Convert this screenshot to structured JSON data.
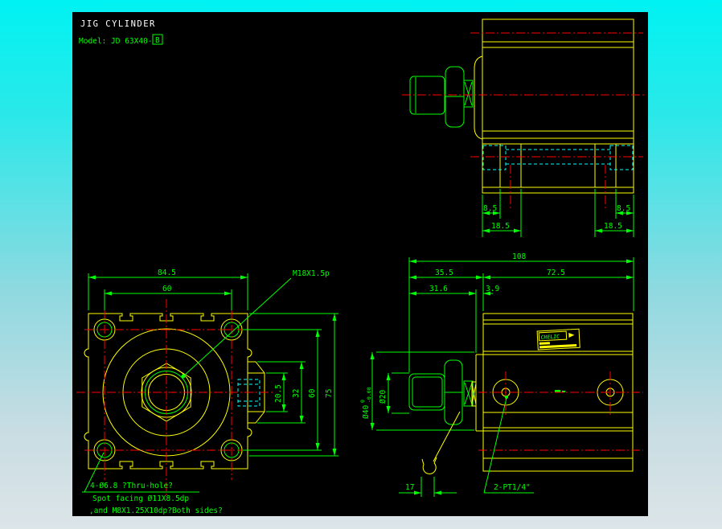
{
  "header": {
    "title": "JIG CYLINDER",
    "model_label": "Model: JD 63X40-",
    "model_code": "B"
  },
  "front_view": {
    "dim_width": "84.5",
    "dim_hole_spacing": "60",
    "thread_callout": "M18X1.5p",
    "dim_port_width": "20.5",
    "dim_boss": "32",
    "dim_hole_spacing_v": "60",
    "dim_height": "75",
    "note_line1": "4-Ø6.8 ?Thru-hole?",
    "note_line2": "Spot facing Ø11X8.5dp",
    "note_line3": ",and M8X1.25X10dp?Both sides?"
  },
  "top_view": {
    "dim_left_offset": "8.5",
    "dim_left_slot": "18.5",
    "dim_right_offset": "8.5",
    "dim_right_slot": "18.5"
  },
  "side_view": {
    "dim_overall": "108",
    "dim_rod_side": "35.5",
    "dim_body": "72.5",
    "dim_rod_inner": "31.6",
    "dim_flange": "3.9",
    "dia_boss": "Ø40",
    "dia_boss_tol_upper": "0",
    "dia_boss_tol_lower": "-0.08",
    "dia_rod": "Ø20",
    "dim_wrench_flats": "17",
    "port_callout": "2-PT1/4\"",
    "nameplate_brand": "CHELIC"
  },
  "colors": {
    "canvas_bg": "#000000",
    "line_primary": "#ffff00",
    "line_dimension": "#00ff00",
    "line_center": "#ff0000",
    "line_hidden": "#00ffff",
    "title_text": "#ffffff"
  }
}
